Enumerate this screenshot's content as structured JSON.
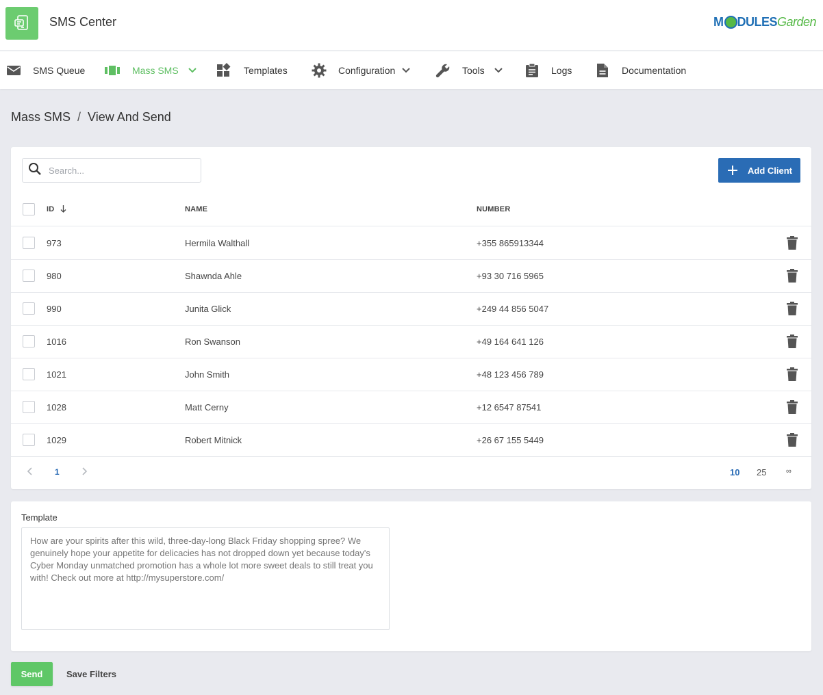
{
  "header": {
    "app_title": "SMS Center",
    "brand": {
      "part1": "M",
      "part2": "DULES",
      "part3": "Garden"
    }
  },
  "nav": {
    "items": [
      {
        "label": "SMS Queue",
        "icon": "envelope-icon"
      },
      {
        "label": "Mass SMS",
        "icon": "carousel-icon",
        "active": true,
        "has_dropdown": true
      },
      {
        "label": "Templates",
        "icon": "widgets-icon"
      },
      {
        "label": "Configuration",
        "icon": "gear-icon",
        "has_dropdown": true
      },
      {
        "label": "Tools",
        "icon": "wrench-icon",
        "has_dropdown": true
      },
      {
        "label": "Logs",
        "icon": "clipboard-icon"
      },
      {
        "label": "Documentation",
        "icon": "document-icon"
      }
    ]
  },
  "breadcrumb": {
    "parent": "Mass SMS",
    "separator": "/",
    "current": "View And Send"
  },
  "table": {
    "search_placeholder": "Search...",
    "add_button": "Add Client",
    "columns": {
      "id": "ID",
      "name": "NAME",
      "number": "NUMBER"
    },
    "rows": [
      {
        "id": "973",
        "name": "Hermila Walthall",
        "number": "+355 865913344"
      },
      {
        "id": "980",
        "name": "Shawnda Ahle",
        "number": "+93 30 716 5965"
      },
      {
        "id": "990",
        "name": "Junita Glick",
        "number": "+249 44 856 5047"
      },
      {
        "id": "1016",
        "name": "Ron Swanson",
        "number": "+49 164 641 126"
      },
      {
        "id": "1021",
        "name": "John Smith",
        "number": "+48 123 456 789"
      },
      {
        "id": "1028",
        "name": "Matt Cerny",
        "number": "+12 6547 87541"
      },
      {
        "id": "1029",
        "name": "Robert Mitnick",
        "number": "+26 67 155 5449"
      }
    ],
    "pagination": {
      "current_page": "1",
      "page_sizes": [
        "10",
        "25",
        "∞"
      ],
      "active_size": "10"
    }
  },
  "template": {
    "label": "Template",
    "placeholder": "How are your spirits after this wild, three-day-long Black Friday shopping spree? We genuinely hope your appetite for delicacies has not dropped down yet because today's Cyber Monday unmatched promotion has a whole lot more sweet deals to still treat you with! Check out more at http://mysuperstore.com/"
  },
  "actions": {
    "send": "Send",
    "save_filters": "Save Filters"
  },
  "colors": {
    "accent_green": "#5fc767",
    "primary_blue": "#2a6cb5",
    "background": "#e9eaef"
  }
}
